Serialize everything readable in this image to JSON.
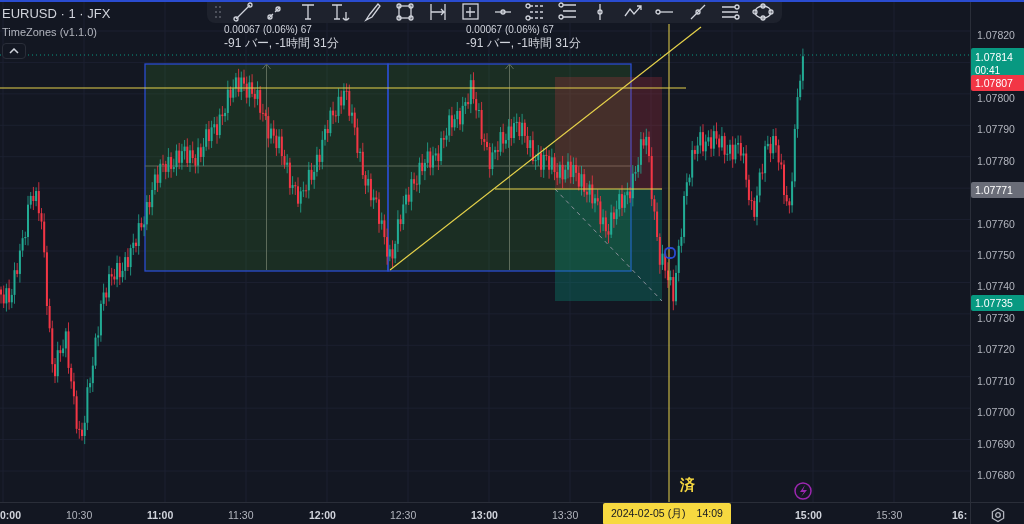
{
  "legend": {
    "symbol": "EURUSD · 1 · JFX",
    "indicator": "TimeZones (v1.1.0)"
  },
  "measurements": [
    {
      "value": "0.00067 (0.06%) 67",
      "duration": "-91 バー, -1時間 31分"
    },
    {
      "value": "0.00067 (0.06%) 67",
      "duration": "-91 バー, -1時間 31分"
    }
  ],
  "price_axis": {
    "labels": [
      "1.07820",
      "1.07800",
      "1.07790",
      "1.07780",
      "1.07760",
      "1.07750",
      "1.07740",
      "1.07730",
      "1.07720",
      "1.07710",
      "1.07700",
      "1.07690",
      "1.07680"
    ],
    "tags": [
      {
        "kind": "last",
        "text": "1.07814",
        "countdown": "00:41",
        "color": "#089981"
      },
      {
        "kind": "plain",
        "text": "1.07807",
        "color": "#f23645"
      },
      {
        "kind": "plain",
        "text": "1.07771",
        "color": "#6a6d78"
      },
      {
        "kind": "plain",
        "text": "1.07735",
        "color": "#089981"
      }
    ]
  },
  "time_axis": {
    "labels": [
      {
        "text": "0:00",
        "bold": true
      },
      {
        "text": "10:30",
        "bold": false
      },
      {
        "text": "11:00",
        "bold": true
      },
      {
        "text": "11:30",
        "bold": false
      },
      {
        "text": "12:00",
        "bold": true
      },
      {
        "text": "12:30",
        "bold": false
      },
      {
        "text": "13:00",
        "bold": true
      },
      {
        "text": "13:30",
        "bold": false
      },
      {
        "text": "15:00",
        "bold": true
      },
      {
        "text": "15:30",
        "bold": false
      },
      {
        "text": "16:",
        "bold": true
      }
    ],
    "crosshair_date": "2024-02-05 (月)　14:09"
  },
  "marker_text": "済"
}
